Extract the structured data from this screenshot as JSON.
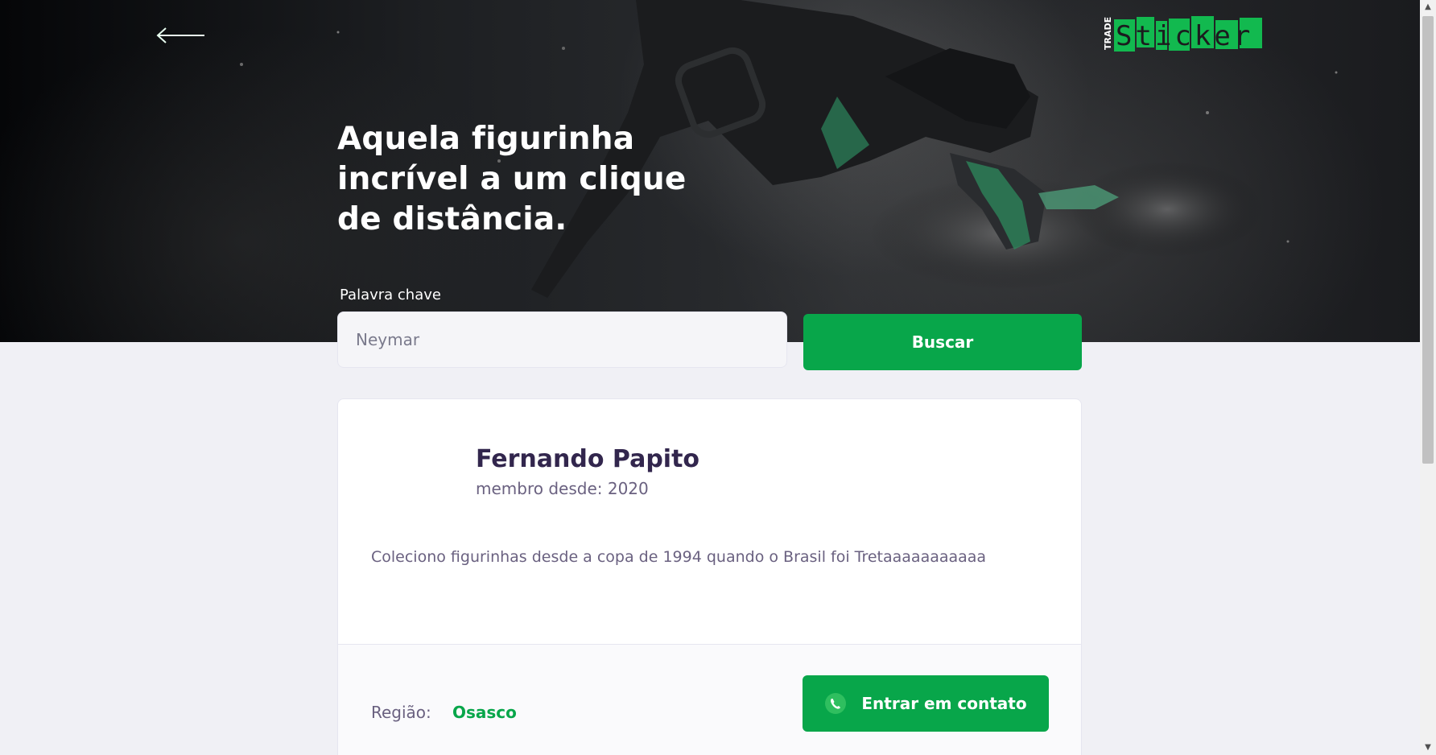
{
  "hero": {
    "title": "Aquela figurinha incrível a um clique de distância.",
    "back_icon": "arrow-left-icon",
    "logo": {
      "small_text": "TRADE",
      "big_text": "Sticker"
    }
  },
  "search": {
    "label": "Palavra chave",
    "placeholder": "Neymar",
    "value": "",
    "button_label": "Buscar"
  },
  "profile": {
    "name": "Fernando Papito",
    "member_since": "membro desde: 2020",
    "bio": "Coleciono figurinhas desde a copa de 1994 quando o Brasil foi Tretaaaaaaaaaaa",
    "region_label": "Região:",
    "region_value": "Osasco",
    "contact_button_label": "Entrar em contato",
    "contact_icon": "whatsapp-icon"
  },
  "colors": {
    "accent": "#08a64a",
    "title_text": "#32264d",
    "body_text": "#6a6180",
    "page_bg": "#f0f0f5"
  }
}
